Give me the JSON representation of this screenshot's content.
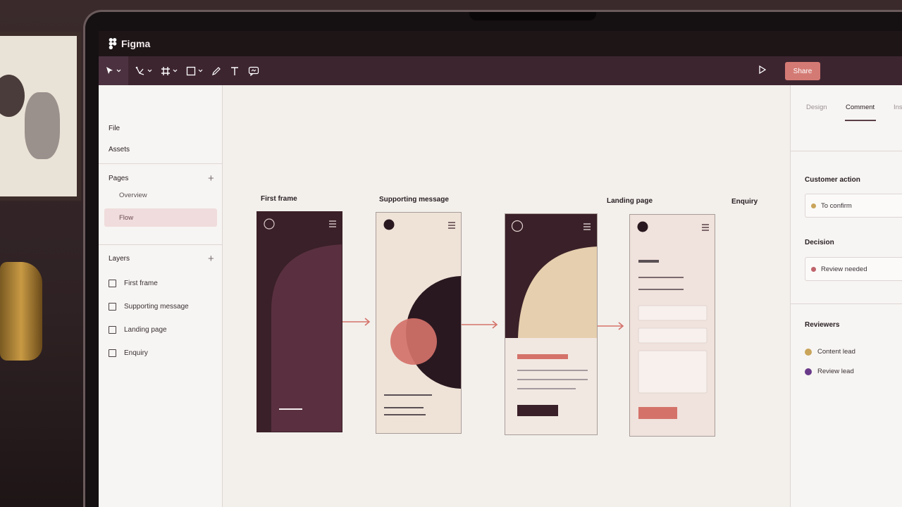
{
  "app": {
    "title": "Figma"
  },
  "toolbar": {
    "tools": [
      "move-tool",
      "pen-crop-tool",
      "frame-tool",
      "shape-tool",
      "pencil-tool",
      "text-tool",
      "comment-tool"
    ],
    "share_label": "Share"
  },
  "left_panel": {
    "file_label": "File",
    "assets_label": "Assets",
    "pages_label": "Pages",
    "pages": [
      {
        "label": "Overview",
        "selected": false
      },
      {
        "label": "Flow",
        "selected": true
      }
    ],
    "layers_label": "Layers",
    "layers": [
      "First frame",
      "Supporting message",
      "Landing page",
      "Enquiry"
    ]
  },
  "right_panel": {
    "tabs": [
      "Design",
      "Comment",
      "Ins"
    ],
    "active_tab": "Comment",
    "customer_action": {
      "heading": "Customer action",
      "value": "To confirm",
      "color": "#c9a45a"
    },
    "decision": {
      "heading": "Decision",
      "value": "Review needed",
      "color": "#c0646c"
    },
    "reviewers": {
      "heading": "Reviewers",
      "items": [
        {
          "label": "Content lead",
          "color": "#c9a45a"
        },
        {
          "label": "Review lead",
          "color": "#6a3a8a"
        }
      ]
    }
  },
  "canvas": {
    "frames": [
      {
        "label": "First frame"
      },
      {
        "label": "Supporting message"
      },
      {
        "label": "Landing page"
      },
      {
        "label": "Enquiry"
      }
    ]
  },
  "colors": {
    "plum": "#3a2028",
    "mauve": "#5a3040",
    "cream": "#efe3d8",
    "sand": "#e6cfae",
    "coral": "#d4726a",
    "accent_share": "#d47a74"
  }
}
